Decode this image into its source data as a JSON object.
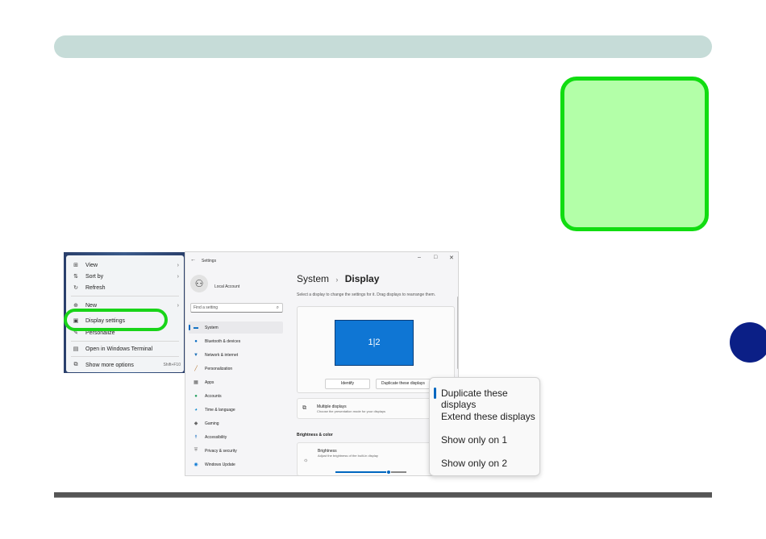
{
  "colors": {
    "top_bar": "#c6dcd8",
    "note_fill": "#b3ffa8",
    "note_border": "#11dd11",
    "side_tab": "#0b1f86",
    "accent": "#0067c0"
  },
  "context_menu": {
    "items": [
      {
        "icon": "grid-icon",
        "label": "View",
        "has_submenu": true
      },
      {
        "icon": "sort-icon",
        "label": "Sort by",
        "has_submenu": true
      },
      {
        "icon": "refresh-icon",
        "label": "Refresh"
      },
      {
        "icon": "new-icon",
        "label": "New",
        "has_submenu": true
      },
      {
        "icon": "display-icon",
        "label": "Display settings"
      },
      {
        "icon": "brush-icon",
        "label": "Personalize"
      },
      {
        "icon": "terminal-icon",
        "label": "Open in Windows Terminal"
      },
      {
        "icon": "more-options-icon",
        "label": "Show more options",
        "shortcut": "Shift+F10"
      }
    ]
  },
  "settings": {
    "window_title": "Settings",
    "account_name": "Local Account",
    "search_placeholder": "Find a setting",
    "nav": [
      {
        "icon": "system-icon",
        "label": "System"
      },
      {
        "icon": "bluetooth-icon",
        "label": "Bluetooth & devices"
      },
      {
        "icon": "network-icon",
        "label": "Network & internet"
      },
      {
        "icon": "personalization-icon",
        "label": "Personalization"
      },
      {
        "icon": "apps-icon",
        "label": "Apps"
      },
      {
        "icon": "accounts-icon",
        "label": "Accounts"
      },
      {
        "icon": "time-language-icon",
        "label": "Time & language"
      },
      {
        "icon": "gaming-icon",
        "label": "Gaming"
      },
      {
        "icon": "accessibility-icon",
        "label": "Accessibility"
      },
      {
        "icon": "privacy-icon",
        "label": "Privacy & security"
      },
      {
        "icon": "windows-update-icon",
        "label": "Windows Update"
      }
    ],
    "breadcrumb_parent": "System",
    "breadcrumb_sep": "›",
    "page_title": "Display",
    "description": "Select a display to change the settings for it. Drag displays to rearrange them.",
    "monitor_label": "1|2",
    "identify_label": "Identify",
    "duplicate_button_label": "Duplicate these displays",
    "multiple_displays_title": "Multiple displays",
    "multiple_displays_sub": "Choose the presentation mode for your displays",
    "brightness_section": "Brightness & color",
    "brightness_title": "Brightness",
    "brightness_sub": "Adjust the brightness of the built-in display",
    "brightness_level": 0.75
  },
  "dropdown": {
    "options": [
      "Duplicate these displays",
      "Extend these displays",
      "Show only on 1",
      "Show only on 2"
    ],
    "selected_index": 0
  }
}
